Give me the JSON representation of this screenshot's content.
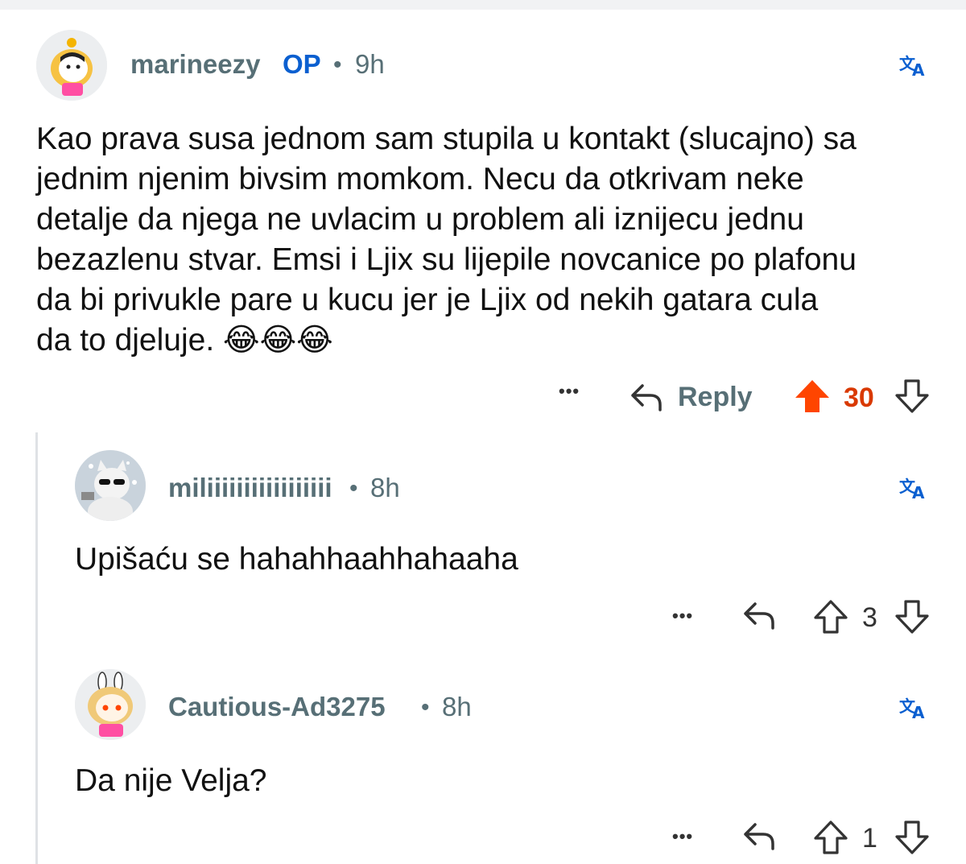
{
  "comments": [
    {
      "username": "marineezy",
      "op_badge": "OP",
      "separator": "•",
      "time": "9h",
      "text_lines": [
        "Kao prava susa jednom sam stupila u kontakt (slucajno) sa",
        "jednim njenim bivsim momkom. Necu da otkrivam neke",
        "detalje da njega ne uvlacim u problem ali iznijecu jednu",
        "bezazlenu stvar. Emsi i Ljix su lijepile novcanice po plafonu",
        "da bi privukle pare u kucu jer je Ljix od nekih gatara cula",
        "da to djeluje. 😂😂😂"
      ],
      "reply_label": "Reply",
      "more_label": "•••",
      "votes": "30",
      "vote_state": "upvoted",
      "upvote_color": "#d93900"
    },
    {
      "username": "miliiiiiiiiiiiiiiiii",
      "separator": "•",
      "time": "8h",
      "text": "Upišaću se hahahhaahhahaaha",
      "more_label": "•••",
      "votes": "3"
    },
    {
      "username": "Cautious-Ad3275",
      "separator": "•",
      "time": "8h",
      "text": "Da nije Velja?",
      "more_label": "•••",
      "votes": "1"
    }
  ],
  "icons": {
    "translate": "translate-icon",
    "reply": "reply-arrow-icon",
    "upvote": "upvote-arrow-icon",
    "downvote": "downvote-arrow-icon"
  }
}
